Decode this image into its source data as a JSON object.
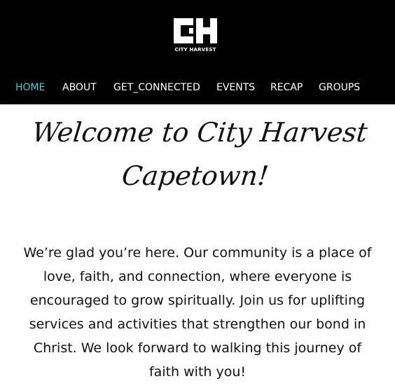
{
  "logo": {
    "mark": "CH",
    "name": "CITY HARVEST"
  },
  "nav": {
    "items": [
      {
        "label": "HOME",
        "active": true
      },
      {
        "label": "ABOUT",
        "active": false
      },
      {
        "label": "GET_CONNECTED",
        "active": false
      },
      {
        "label": "EVENTS",
        "active": false
      },
      {
        "label": "RECAP",
        "active": false
      },
      {
        "label": "GROUPS",
        "active": false
      }
    ]
  },
  "hero": {
    "title_line1": "Welcome to City Harvest",
    "title_line2": "Capetown!"
  },
  "intro": {
    "text": "We’re glad you’re here. Our community is a place of love, faith, and connection, where everyone is encouraged to grow spiritually. Join us for uplifting services and activities that strengthen our bond in Christ. We look forward to walking this journey of faith with you!"
  },
  "colors": {
    "header_bg": "#000000",
    "nav_active": "#2fd3d9",
    "nav_text": "#ffffff",
    "body_text": "#111111"
  }
}
